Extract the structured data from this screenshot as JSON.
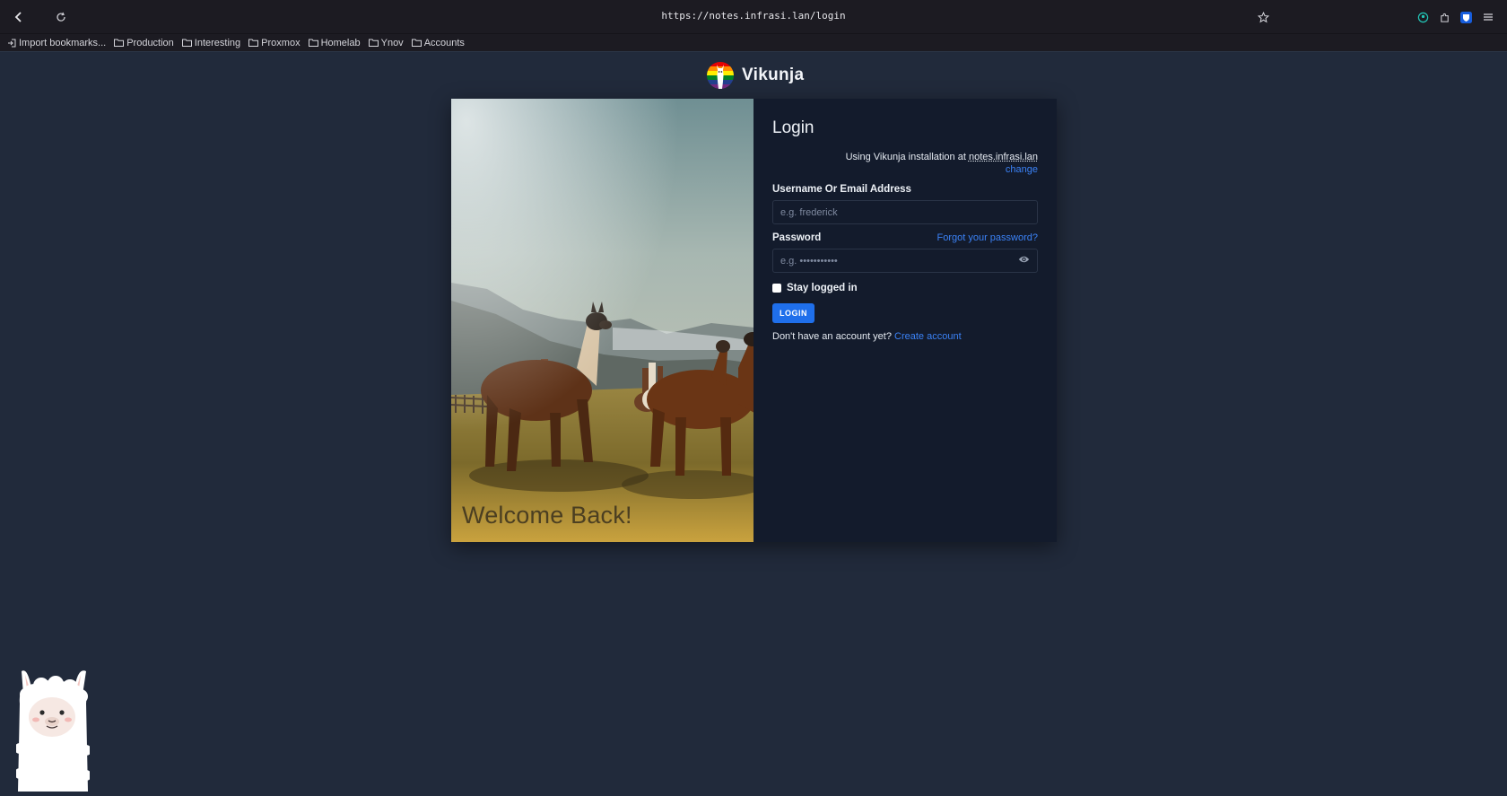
{
  "browser": {
    "url": "https://notes.infrasi.lan/login",
    "bookmarks": [
      {
        "label": "Import bookmarks...",
        "icon": "import-icon"
      },
      {
        "label": "Production",
        "icon": "folder-icon"
      },
      {
        "label": "Interesting",
        "icon": "folder-icon"
      },
      {
        "label": "Proxmox",
        "icon": "folder-icon"
      },
      {
        "label": "Homelab",
        "icon": "folder-icon"
      },
      {
        "label": "Ynov",
        "icon": "folder-icon"
      },
      {
        "label": "Accounts",
        "icon": "folder-icon"
      }
    ]
  },
  "app": {
    "name": "Vikunja"
  },
  "card": {
    "welcome": "Welcome Back!"
  },
  "login": {
    "title": "Login",
    "install_prefix": "Using Vikunja installation at ",
    "install_host": "notes.infrasi.lan",
    "change_label": "change",
    "username_label": "Username Or Email Address",
    "username_placeholder": "e.g. frederick",
    "password_label": "Password",
    "forgot_label": "Forgot your password?",
    "password_placeholder": "e.g. •••••••••••",
    "stay_logged_in": "Stay logged in",
    "login_button": "LOGIN",
    "no_account_text": "Don't have an account yet?",
    "create_account": "Create account"
  },
  "colors": {
    "page_bg": "#212a3b",
    "card_bg": "#131b2c",
    "accent": "#1f6feb",
    "link": "#3b82f6"
  }
}
